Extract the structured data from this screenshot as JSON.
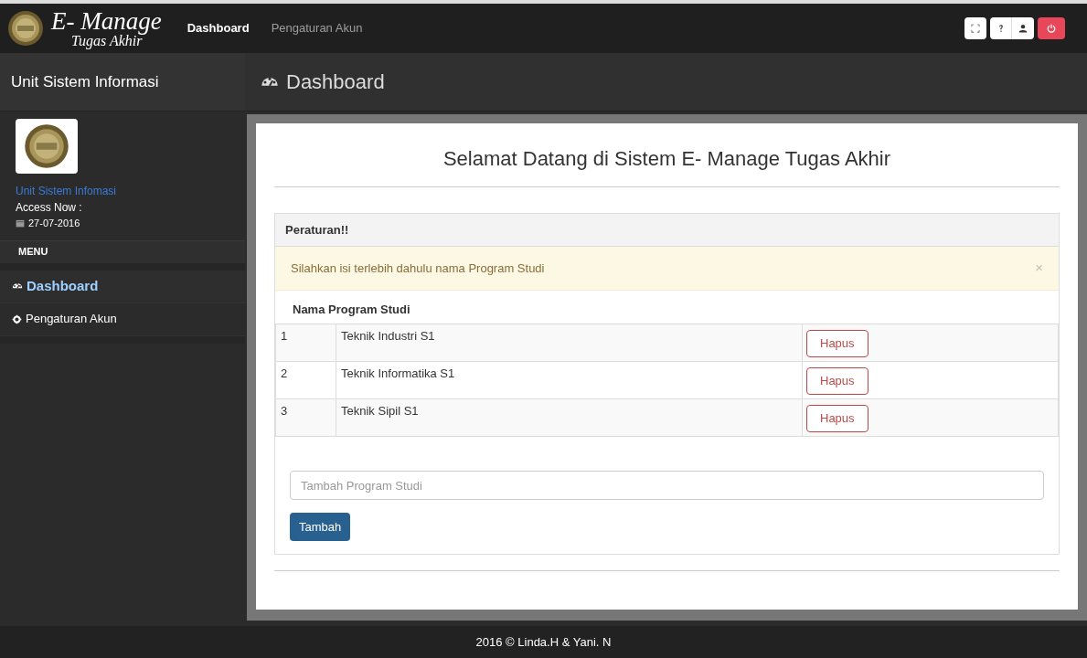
{
  "navbar": {
    "brand_title": "E- Manage",
    "brand_subtitle": "Tugas Akhir",
    "links": [
      {
        "label": "Dashboard",
        "selected": true
      },
      {
        "label": "Pengaturan Akun",
        "selected": false
      }
    ]
  },
  "sidebar": {
    "title": "Unit Sistem Informasi",
    "user_name": "Unit Sistem Infomasi",
    "access_label": "Access Now :",
    "date": "27-07-2016",
    "menu_heading": "MENU",
    "items": [
      {
        "label": "Dashboard",
        "kind": "dashboard",
        "selected": true
      },
      {
        "label": "Pengaturan Akun",
        "kind": "settings",
        "selected": false
      }
    ]
  },
  "page_header": {
    "title": "Dashboard"
  },
  "content": {
    "heading": "Selamat Datang di Sistem E- Manage Tugas Akhir",
    "panel_title": "Peraturan!!",
    "alert": {
      "text": "Silahkan isi terlebih dahulu nama Program Studi",
      "close": "×"
    },
    "table_title": "Nama Program Studi",
    "rows": [
      {
        "no": "1",
        "name": "Teknik Industri S1",
        "action": "Hapus"
      },
      {
        "no": "2",
        "name": "Teknik Informatika S1",
        "action": "Hapus"
      },
      {
        "no": "3",
        "name": "Teknik Sipil S1",
        "action": "Hapus"
      }
    ],
    "input": {
      "placeholder": "Tambah Program Studi"
    },
    "submit": "Tambah"
  },
  "footer": "2016 © Linda.H & Yani. N"
}
